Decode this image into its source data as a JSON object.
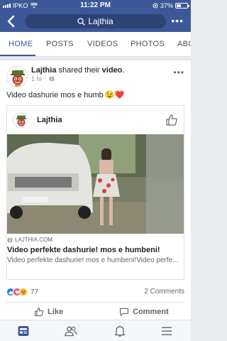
{
  "status_bar": {
    "carrier": "IPKO",
    "time": "11:22 PM",
    "battery": "37%"
  },
  "header": {
    "search_text": "Lajthia"
  },
  "tabs": [
    {
      "label": "HOME"
    },
    {
      "label": "POSTS"
    },
    {
      "label": "VIDEOS"
    },
    {
      "label": "PHOTOS"
    },
    {
      "label": "ABO"
    }
  ],
  "post": {
    "author": "Lajthia",
    "action_text": " shared their ",
    "action_object": "video",
    "action_end": ".",
    "time": "1 hr",
    "time_sep": " · ",
    "text": "Video dashurie mos e humb",
    "emoji": "😉❤️",
    "shared": {
      "page_name": "Lajthia",
      "link_domain": "LAJTHIA.COM",
      "link_title": "Video perfekte dashurie! mos e humbeni!",
      "link_description": "Video perfekte dashurie! mos e humbeni!Video perfe..."
    },
    "reaction_count": "77",
    "comments": "2 Comments",
    "like_label": "Like",
    "comment_label": "Comment"
  },
  "colors": {
    "brand": "#3b5998",
    "like": "#1877f2",
    "love": "#e9505d",
    "haha": "#f7b125"
  }
}
